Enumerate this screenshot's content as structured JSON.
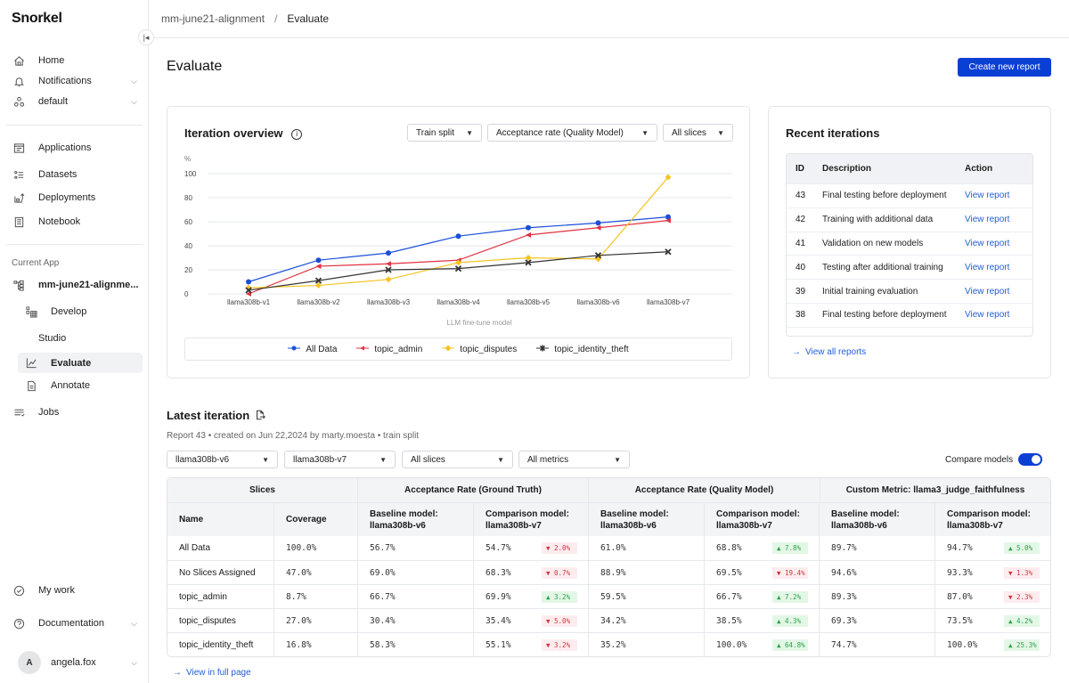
{
  "app": {
    "logo": "Snorkel"
  },
  "sidebar": {
    "top_items": [
      {
        "label": "Home",
        "icon": "home-icon"
      },
      {
        "label": "Notifications",
        "icon": "bell-icon",
        "expandable": true
      },
      {
        "label": "default",
        "icon": "workspace-icon",
        "expandable": true
      }
    ],
    "main_items": [
      {
        "label": "Applications",
        "icon": "applications-icon"
      },
      {
        "label": "Datasets",
        "icon": "datasets-icon"
      },
      {
        "label": "Deployments",
        "icon": "deployments-icon"
      },
      {
        "label": "Notebook",
        "icon": "notebook-icon"
      }
    ],
    "current_app_label": "Current App",
    "current_app": "mm-june21-alignme...",
    "app_items": [
      {
        "label": "Develop",
        "icon": "develop-icon"
      },
      {
        "label": "Studio"
      },
      {
        "label": "Evaluate",
        "icon": "evaluate-icon",
        "active": true
      },
      {
        "label": "Annotate",
        "icon": "annotate-icon"
      }
    ],
    "jobs": "Jobs",
    "bottom": {
      "my_work": "My work",
      "documentation": "Documentation",
      "user_initial": "A",
      "user_name": "angela.fox"
    }
  },
  "breadcrumb": {
    "app": "mm-june21-alignment",
    "separator": "/",
    "current": "Evaluate"
  },
  "page": {
    "title": "Evaluate",
    "create_button": "Create new report"
  },
  "overview": {
    "title": "Iteration overview",
    "filters": {
      "split": "Train split",
      "metric": "Acceptance rate (Quality Model)",
      "slices": "All slices"
    }
  },
  "chart_data": {
    "type": "line",
    "title": "Iteration overview",
    "xlabel": "LLM fine-tune model",
    "ylabel": "%",
    "ylim": [
      0,
      100
    ],
    "yticks": [
      0,
      20,
      40,
      60,
      80,
      100
    ],
    "grid": true,
    "legend_position": "bottom",
    "categories": [
      "llama308b-v1",
      "llama308b-v2",
      "llama308b-v3",
      "llama308b-v4",
      "llama308b-v5",
      "llama308b-v6",
      "llama308b-v7"
    ],
    "series": [
      {
        "name": "All Data",
        "color": "#1a4fd8",
        "marker": "circle",
        "values": [
          10,
          28,
          34,
          48,
          55,
          59,
          64
        ]
      },
      {
        "name": "topic_admin",
        "color": "#e0323f",
        "marker": "triangle",
        "values": [
          0,
          23,
          25,
          28,
          49,
          55,
          61
        ]
      },
      {
        "name": "topic_disputes",
        "color": "#f5c423",
        "marker": "diamond",
        "values": [
          5,
          7,
          12,
          26,
          30,
          29,
          97
        ]
      },
      {
        "name": "topic_identity_theft",
        "color": "#333333",
        "marker": "x",
        "values": [
          3,
          11,
          20,
          21,
          26,
          32,
          35
        ]
      }
    ]
  },
  "recent": {
    "title": "Recent iterations",
    "columns": [
      "ID",
      "Description",
      "Action"
    ],
    "rows": [
      {
        "id": "43",
        "description": "Final testing before deployment",
        "action": "View report"
      },
      {
        "id": "42",
        "description": "Training with additional data",
        "action": "View report"
      },
      {
        "id": "41",
        "description": "Validation on new models",
        "action": "View report"
      },
      {
        "id": "40",
        "description": "Testing after additional training",
        "action": "View report"
      },
      {
        "id": "39",
        "description": "Initial training evaluation",
        "action": "View report"
      },
      {
        "id": "38",
        "description": "Final testing before deployment",
        "action": "View report"
      }
    ],
    "view_all": "View all reports"
  },
  "latest": {
    "title": "Latest iteration",
    "meta": "Report 43 • created on Jun 22,2024 by marty.moesta • train split",
    "filters": {
      "baseline": "llama308b-v6",
      "comparison": "llama308b-v7",
      "slices": "All slices",
      "metrics": "All metrics"
    },
    "compare_label": "Compare models",
    "compare_on": true,
    "group_headers": [
      "Slices",
      "Acceptance Rate (Ground Truth)",
      "Acceptance Rate (Quality Model)",
      "Custom Metric: llama3_judge_faithfulness"
    ],
    "col_headers": [
      "Name",
      "Coverage",
      "Baseline model:\nllama308b-v6",
      "Comparison model:\nllama308b-v7",
      "Baseline model:\nllama308b-v6",
      "Comparison model:\nllama308b-v7",
      "Baseline model:\nllama308b-v6",
      "Comparison model:\nllama308b-v7"
    ],
    "rows": [
      {
        "name": "All Data",
        "coverage": "100.0%",
        "gt_base": "56.7%",
        "gt_cmp": "54.7%",
        "gt_delta": "▼ 2.0%",
        "gt_dir": "down",
        "qm_base": "61.0%",
        "qm_cmp": "68.8%",
        "qm_delta": "▲ 7.8%",
        "qm_dir": "up",
        "cm_base": "89.7%",
        "cm_cmp": "94.7%",
        "cm_delta": "▲ 5.0%",
        "cm_dir": "up"
      },
      {
        "name": "No Slices Assigned",
        "coverage": "47.0%",
        "gt_base": "69.0%",
        "gt_cmp": "68.3%",
        "gt_delta": "▼ 0.7%",
        "gt_dir": "down",
        "qm_base": "88.9%",
        "qm_cmp": "69.5%",
        "qm_delta": "▼ 19.4%",
        "qm_dir": "down",
        "cm_base": "94.6%",
        "cm_cmp": "93.3%",
        "cm_delta": "▼ 1.3%",
        "cm_dir": "down"
      },
      {
        "name": "topic_admin",
        "coverage": "8.7%",
        "gt_base": "66.7%",
        "gt_cmp": "69.9%",
        "gt_delta": "▲ 3.2%",
        "gt_dir": "up",
        "qm_base": "59.5%",
        "qm_cmp": "66.7%",
        "qm_delta": "▲ 7.2%",
        "qm_dir": "up",
        "cm_base": "89.3%",
        "cm_cmp": "87.0%",
        "cm_delta": "▼ 2.3%",
        "cm_dir": "down"
      },
      {
        "name": "topic_disputes",
        "coverage": "27.0%",
        "gt_base": "30.4%",
        "gt_cmp": "35.4%",
        "gt_delta": "▼ 5.0%",
        "gt_dir": "down",
        "qm_base": "34.2%",
        "qm_cmp": "38.5%",
        "qm_delta": "▲ 4.3%",
        "qm_dir": "up",
        "cm_base": "69.3%",
        "cm_cmp": "73.5%",
        "cm_delta": "▲ 4.2%",
        "cm_dir": "up"
      },
      {
        "name": "topic_identity_theft",
        "coverage": "16.8%",
        "gt_base": "58.3%",
        "gt_cmp": "55.1%",
        "gt_delta": "▼ 3.2%",
        "gt_dir": "down",
        "qm_base": "35.2%",
        "qm_cmp": "100.0%",
        "qm_delta": "▲ 64.8%",
        "qm_dir": "up",
        "cm_base": "74.7%",
        "cm_cmp": "100.0%",
        "cm_delta": "▲ 25.3%",
        "cm_dir": "up"
      }
    ],
    "view_full": "View in full page"
  }
}
